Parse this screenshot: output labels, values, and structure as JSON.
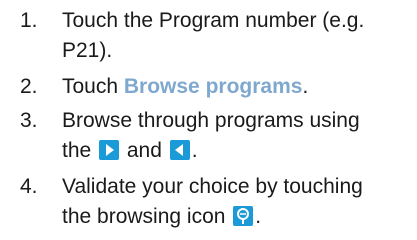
{
  "instructions": {
    "steps": [
      {
        "number": "1.",
        "line1": "Touch the Program number (e.g.",
        "line2": "P21)."
      },
      {
        "number": "2.",
        "prefix": "Touch ",
        "highlight": "Browse programs",
        "suffix": "."
      },
      {
        "number": "3.",
        "line1": "Browse through programs using",
        "line2_prefix": "the ",
        "line2_mid": " and ",
        "line2_end": ".",
        "icons": [
          "arrow-right-icon",
          "arrow-left-icon"
        ]
      },
      {
        "number": "4.",
        "line1": "Validate your choice by touching",
        "line2_prefix": "the browsing icon ",
        "line2_end": ".",
        "icons": [
          "browsing-icon"
        ]
      }
    ]
  },
  "colors": {
    "text": "#1a1a1a",
    "highlight": "#7fa8cf",
    "icon_bg": "#1a9ad6",
    "icon_fg": "#ffffff"
  }
}
